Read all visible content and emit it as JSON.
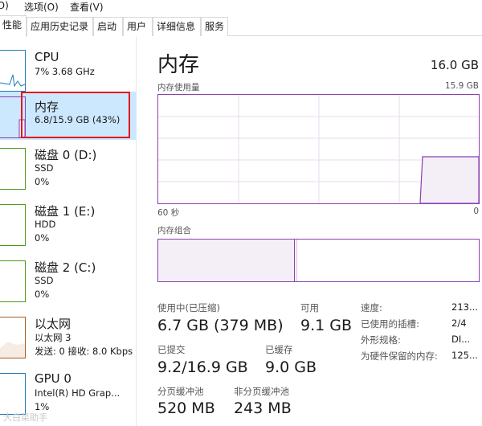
{
  "menu": {
    "items": [
      "(O)",
      "选项(O)",
      "查看(V)"
    ]
  },
  "tabs": [
    "性能",
    "应用历史记录",
    "启动",
    "用户",
    "详细信息",
    "服务"
  ],
  "sidebar": {
    "items": [
      {
        "title": "CPU",
        "sub1": "7% 3.68 GHz",
        "sub2": "",
        "color": "#1d7ab8"
      },
      {
        "title": "内存",
        "sub1": "6.8/15.9 GB (43%)",
        "sub2": "",
        "color": "#8b3fae"
      },
      {
        "title": "磁盘 0 (D:)",
        "sub1": "SSD",
        "sub2": "0%",
        "color": "#4b9a13"
      },
      {
        "title": "磁盘 1 (E:)",
        "sub1": "HDD",
        "sub2": "0%",
        "color": "#4b9a13"
      },
      {
        "title": "磁盘 2 (C:)",
        "sub1": "SSD",
        "sub2": "0%",
        "color": "#4b9a13"
      },
      {
        "title": "以太网",
        "sub1": "以太网 3",
        "sub2": "发送: 0 接收: 8.0 Kbps",
        "color": "#a75b1b"
      },
      {
        "title": "GPU 0",
        "sub1": "Intel(R) HD Grap...",
        "sub2": "1%",
        "color": "#1d7ab8"
      }
    ]
  },
  "main": {
    "title": "内存",
    "total": "16.0 GB",
    "usage_label": "内存使用量",
    "usage_max": "15.9 GB",
    "axis_left": "60 秒",
    "axis_right": "0",
    "composition_label": "内存组合",
    "usage_fraction": 0.43,
    "stats": {
      "in_use_label": "使用中(已压缩)",
      "in_use_value": "6.7 GB (379 MB)",
      "available_label": "可用",
      "available_value": "9.1 GB",
      "committed_label": "已提交",
      "committed_value": "9.2/16.9 GB",
      "cached_label": "已缓存",
      "cached_value": "9.0 GB",
      "paged_label": "分页缓冲池",
      "paged_value": "520 MB",
      "nonpaged_label": "非分页缓冲池",
      "nonpaged_value": "243 MB"
    },
    "details": [
      {
        "key": "速度:",
        "value": "213..."
      },
      {
        "key": "已使用的插槽:",
        "value": "2/4"
      },
      {
        "key": "外形规格:",
        "value": "DI..."
      },
      {
        "key": "为硬件保留的内存:",
        "value": "125..."
      }
    ]
  },
  "watermark": "大白菜助手",
  "colors": {
    "memory": "#8b3fae",
    "memory_fill": "#f4eff7",
    "selected": "#cce8ff",
    "highlight": "#e0191e"
  }
}
